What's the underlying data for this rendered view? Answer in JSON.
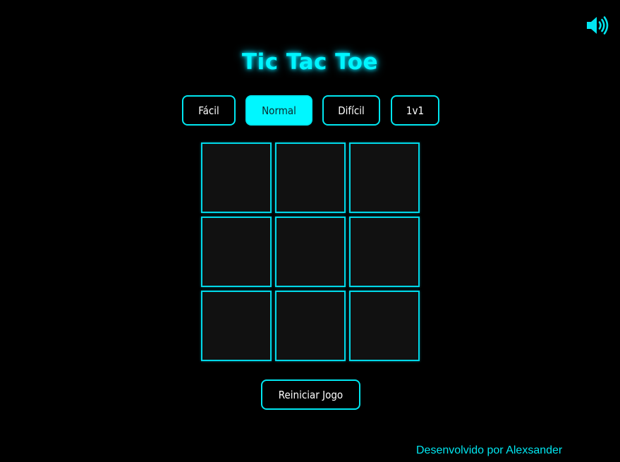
{
  "game": {
    "title": "Tic Tac Toe",
    "accent_color": "#00f5ff",
    "sound_icon": "speaker-volume-icon"
  },
  "difficulty": {
    "selected": "Normal",
    "options": [
      "Fácil",
      "Normal",
      "Difícil",
      "1v1"
    ]
  },
  "board": {
    "cells": [
      "",
      "",
      "",
      "",
      "",
      "",
      "",
      "",
      ""
    ]
  },
  "controls": {
    "reset_label": "Reiniciar Jogo"
  },
  "footer": {
    "credit": "Desenvolvido por Alexsander"
  }
}
